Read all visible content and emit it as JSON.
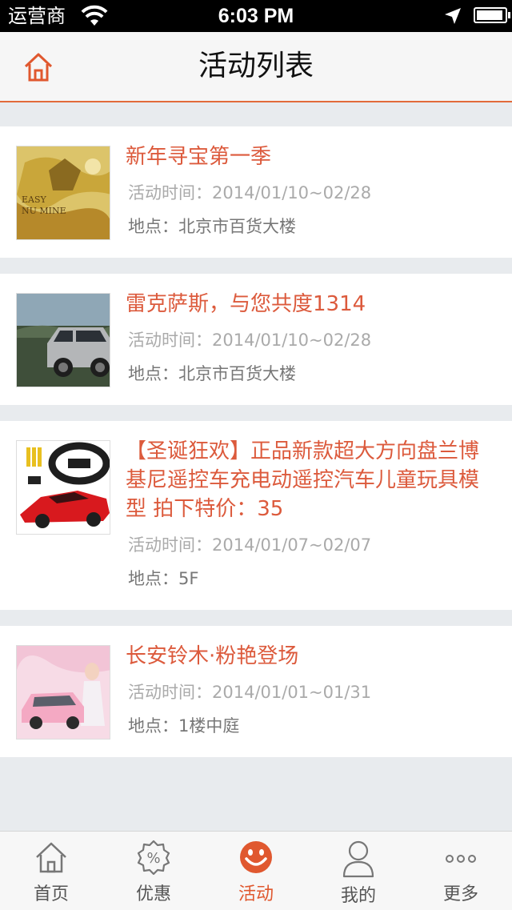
{
  "status": {
    "carrier": "运营商",
    "time": "6:03 PM"
  },
  "nav": {
    "title": "活动列表",
    "home_icon": "home-icon"
  },
  "events": [
    {
      "title": "新年寻宝第一季",
      "time_label": "活动时间：",
      "time": "2014/01/10~02/28",
      "place_label": "地点：",
      "place": "北京市百货大楼"
    },
    {
      "title": "雷克萨斯，与您共度1314",
      "time_label": "活动时间：",
      "time": "2014/01/10~02/28",
      "place_label": "地点：",
      "place": "北京市百货大楼"
    },
    {
      "title": "【圣诞狂欢】正品新款超大方向盘兰博基尼遥控车充电动遥控汽车儿童玩具模型 拍下特价：35",
      "time_label": "活动时间：",
      "time": "2014/01/07~02/07",
      "place_label": "地点：",
      "place": "5F"
    },
    {
      "title": "长安铃木·粉艳登场",
      "time_label": "活动时间：",
      "time": "2014/01/01~01/31",
      "place_label": "地点：",
      "place": "1楼中庭"
    }
  ],
  "tabs": [
    {
      "label": "首页",
      "icon": "home-icon"
    },
    {
      "label": "优惠",
      "icon": "discount-icon"
    },
    {
      "label": "活动",
      "icon": "smiley-icon",
      "active": true
    },
    {
      "label": "我的",
      "icon": "person-icon"
    },
    {
      "label": "更多",
      "icon": "more-icon"
    }
  ],
  "colors": {
    "accent": "#e0582f",
    "title_red": "#dc5a3c",
    "background": "#e8ebee"
  }
}
